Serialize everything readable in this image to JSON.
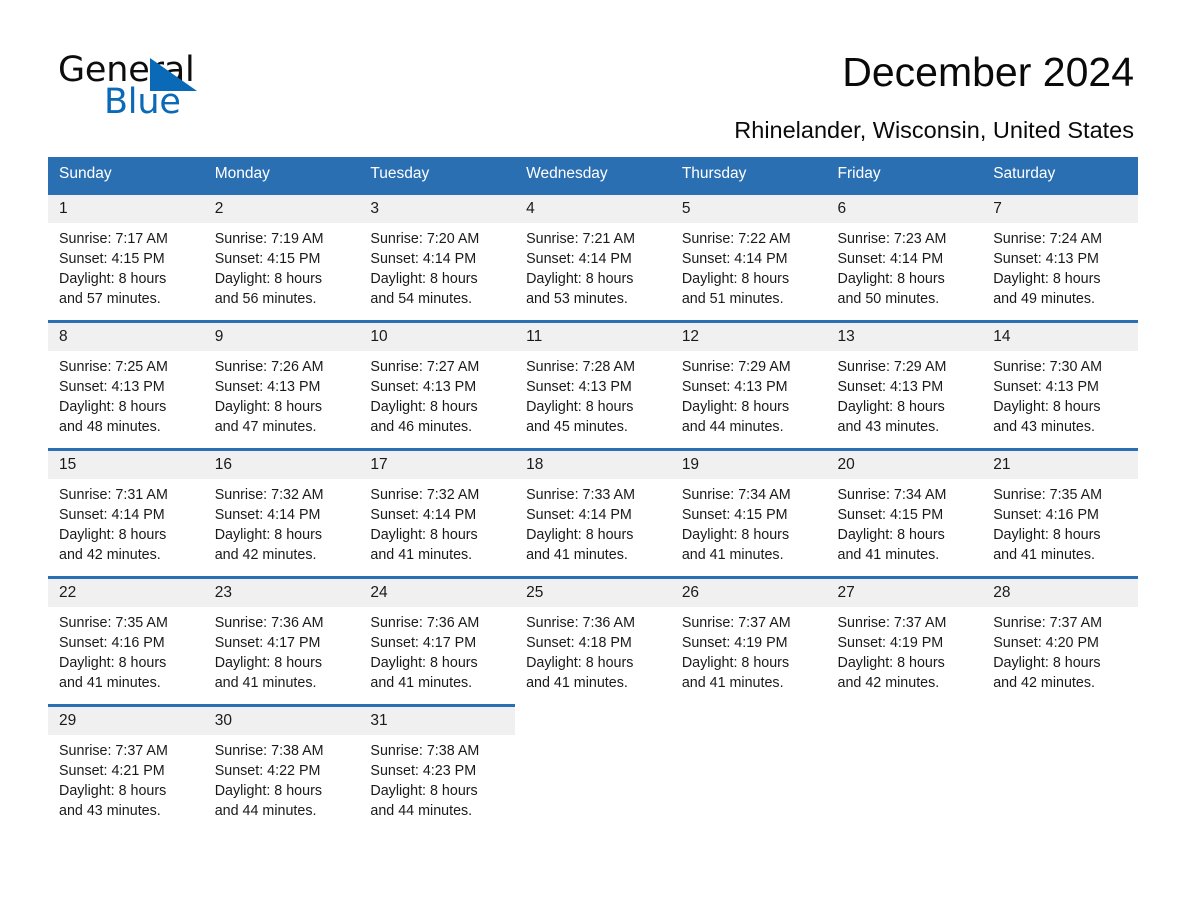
{
  "brand": {
    "name_part1": "General",
    "name_part2": "Blue",
    "triangle_color": "#0b6ab8",
    "accent_color": "#2B6FB3"
  },
  "header": {
    "title": "December 2024",
    "subtitle": "Rhinelander, Wisconsin, United States"
  },
  "calendar": {
    "weekday_headers": [
      "Sunday",
      "Monday",
      "Tuesday",
      "Wednesday",
      "Thursday",
      "Friday",
      "Saturday"
    ],
    "weeks": [
      [
        {
          "day": "1",
          "sunrise": "Sunrise: 7:17 AM",
          "sunset": "Sunset: 4:15 PM",
          "daylight_line1": "Daylight: 8 hours",
          "daylight_line2": "and 57 minutes."
        },
        {
          "day": "2",
          "sunrise": "Sunrise: 7:19 AM",
          "sunset": "Sunset: 4:15 PM",
          "daylight_line1": "Daylight: 8 hours",
          "daylight_line2": "and 56 minutes."
        },
        {
          "day": "3",
          "sunrise": "Sunrise: 7:20 AM",
          "sunset": "Sunset: 4:14 PM",
          "daylight_line1": "Daylight: 8 hours",
          "daylight_line2": "and 54 minutes."
        },
        {
          "day": "4",
          "sunrise": "Sunrise: 7:21 AM",
          "sunset": "Sunset: 4:14 PM",
          "daylight_line1": "Daylight: 8 hours",
          "daylight_line2": "and 53 minutes."
        },
        {
          "day": "5",
          "sunrise": "Sunrise: 7:22 AM",
          "sunset": "Sunset: 4:14 PM",
          "daylight_line1": "Daylight: 8 hours",
          "daylight_line2": "and 51 minutes."
        },
        {
          "day": "6",
          "sunrise": "Sunrise: 7:23 AM",
          "sunset": "Sunset: 4:14 PM",
          "daylight_line1": "Daylight: 8 hours",
          "daylight_line2": "and 50 minutes."
        },
        {
          "day": "7",
          "sunrise": "Sunrise: 7:24 AM",
          "sunset": "Sunset: 4:13 PM",
          "daylight_line1": "Daylight: 8 hours",
          "daylight_line2": "and 49 minutes."
        }
      ],
      [
        {
          "day": "8",
          "sunrise": "Sunrise: 7:25 AM",
          "sunset": "Sunset: 4:13 PM",
          "daylight_line1": "Daylight: 8 hours",
          "daylight_line2": "and 48 minutes."
        },
        {
          "day": "9",
          "sunrise": "Sunrise: 7:26 AM",
          "sunset": "Sunset: 4:13 PM",
          "daylight_line1": "Daylight: 8 hours",
          "daylight_line2": "and 47 minutes."
        },
        {
          "day": "10",
          "sunrise": "Sunrise: 7:27 AM",
          "sunset": "Sunset: 4:13 PM",
          "daylight_line1": "Daylight: 8 hours",
          "daylight_line2": "and 46 minutes."
        },
        {
          "day": "11",
          "sunrise": "Sunrise: 7:28 AM",
          "sunset": "Sunset: 4:13 PM",
          "daylight_line1": "Daylight: 8 hours",
          "daylight_line2": "and 45 minutes."
        },
        {
          "day": "12",
          "sunrise": "Sunrise: 7:29 AM",
          "sunset": "Sunset: 4:13 PM",
          "daylight_line1": "Daylight: 8 hours",
          "daylight_line2": "and 44 minutes."
        },
        {
          "day": "13",
          "sunrise": "Sunrise: 7:29 AM",
          "sunset": "Sunset: 4:13 PM",
          "daylight_line1": "Daylight: 8 hours",
          "daylight_line2": "and 43 minutes."
        },
        {
          "day": "14",
          "sunrise": "Sunrise: 7:30 AM",
          "sunset": "Sunset: 4:13 PM",
          "daylight_line1": "Daylight: 8 hours",
          "daylight_line2": "and 43 minutes."
        }
      ],
      [
        {
          "day": "15",
          "sunrise": "Sunrise: 7:31 AM",
          "sunset": "Sunset: 4:14 PM",
          "daylight_line1": "Daylight: 8 hours",
          "daylight_line2": "and 42 minutes."
        },
        {
          "day": "16",
          "sunrise": "Sunrise: 7:32 AM",
          "sunset": "Sunset: 4:14 PM",
          "daylight_line1": "Daylight: 8 hours",
          "daylight_line2": "and 42 minutes."
        },
        {
          "day": "17",
          "sunrise": "Sunrise: 7:32 AM",
          "sunset": "Sunset: 4:14 PM",
          "daylight_line1": "Daylight: 8 hours",
          "daylight_line2": "and 41 minutes."
        },
        {
          "day": "18",
          "sunrise": "Sunrise: 7:33 AM",
          "sunset": "Sunset: 4:14 PM",
          "daylight_line1": "Daylight: 8 hours",
          "daylight_line2": "and 41 minutes."
        },
        {
          "day": "19",
          "sunrise": "Sunrise: 7:34 AM",
          "sunset": "Sunset: 4:15 PM",
          "daylight_line1": "Daylight: 8 hours",
          "daylight_line2": "and 41 minutes."
        },
        {
          "day": "20",
          "sunrise": "Sunrise: 7:34 AM",
          "sunset": "Sunset: 4:15 PM",
          "daylight_line1": "Daylight: 8 hours",
          "daylight_line2": "and 41 minutes."
        },
        {
          "day": "21",
          "sunrise": "Sunrise: 7:35 AM",
          "sunset": "Sunset: 4:16 PM",
          "daylight_line1": "Daylight: 8 hours",
          "daylight_line2": "and 41 minutes."
        }
      ],
      [
        {
          "day": "22",
          "sunrise": "Sunrise: 7:35 AM",
          "sunset": "Sunset: 4:16 PM",
          "daylight_line1": "Daylight: 8 hours",
          "daylight_line2": "and 41 minutes."
        },
        {
          "day": "23",
          "sunrise": "Sunrise: 7:36 AM",
          "sunset": "Sunset: 4:17 PM",
          "daylight_line1": "Daylight: 8 hours",
          "daylight_line2": "and 41 minutes."
        },
        {
          "day": "24",
          "sunrise": "Sunrise: 7:36 AM",
          "sunset": "Sunset: 4:17 PM",
          "daylight_line1": "Daylight: 8 hours",
          "daylight_line2": "and 41 minutes."
        },
        {
          "day": "25",
          "sunrise": "Sunrise: 7:36 AM",
          "sunset": "Sunset: 4:18 PM",
          "daylight_line1": "Daylight: 8 hours",
          "daylight_line2": "and 41 minutes."
        },
        {
          "day": "26",
          "sunrise": "Sunrise: 7:37 AM",
          "sunset": "Sunset: 4:19 PM",
          "daylight_line1": "Daylight: 8 hours",
          "daylight_line2": "and 41 minutes."
        },
        {
          "day": "27",
          "sunrise": "Sunrise: 7:37 AM",
          "sunset": "Sunset: 4:19 PM",
          "daylight_line1": "Daylight: 8 hours",
          "daylight_line2": "and 42 minutes."
        },
        {
          "day": "28",
          "sunrise": "Sunrise: 7:37 AM",
          "sunset": "Sunset: 4:20 PM",
          "daylight_line1": "Daylight: 8 hours",
          "daylight_line2": "and 42 minutes."
        }
      ],
      [
        {
          "day": "29",
          "sunrise": "Sunrise: 7:37 AM",
          "sunset": "Sunset: 4:21 PM",
          "daylight_line1": "Daylight: 8 hours",
          "daylight_line2": "and 43 minutes."
        },
        {
          "day": "30",
          "sunrise": "Sunrise: 7:38 AM",
          "sunset": "Sunset: 4:22 PM",
          "daylight_line1": "Daylight: 8 hours",
          "daylight_line2": "and 44 minutes."
        },
        {
          "day": "31",
          "sunrise": "Sunrise: 7:38 AM",
          "sunset": "Sunset: 4:23 PM",
          "daylight_line1": "Daylight: 8 hours",
          "daylight_line2": "and 44 minutes."
        },
        {
          "day": "",
          "sunrise": "",
          "sunset": "",
          "daylight_line1": "",
          "daylight_line2": "",
          "blank": true
        },
        {
          "day": "",
          "sunrise": "",
          "sunset": "",
          "daylight_line1": "",
          "daylight_line2": "",
          "blank": true
        },
        {
          "day": "",
          "sunrise": "",
          "sunset": "",
          "daylight_line1": "",
          "daylight_line2": "",
          "blank": true
        },
        {
          "day": "",
          "sunrise": "",
          "sunset": "",
          "daylight_line1": "",
          "daylight_line2": "",
          "blank": true
        }
      ]
    ]
  }
}
